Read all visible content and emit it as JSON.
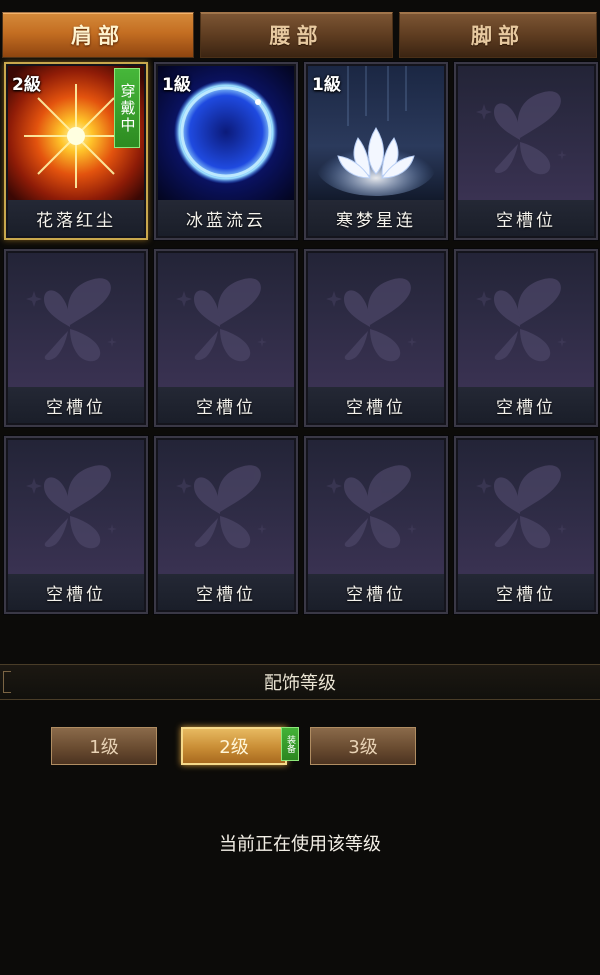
{
  "tabs": [
    {
      "label": "肩部",
      "active": true
    },
    {
      "label": "腰部",
      "active": false
    },
    {
      "label": "脚部",
      "active": false
    }
  ],
  "slots": [
    {
      "name": "花落红尘",
      "level": "2級",
      "badge": "穿戴中",
      "art": "sun-burst-icon",
      "selected": true
    },
    {
      "name": "冰蓝流云",
      "level": "1級",
      "badge": "",
      "art": "blue-orb-icon",
      "selected": false
    },
    {
      "name": "寒梦星连",
      "level": "1級",
      "badge": "",
      "art": "lotus-icon",
      "selected": false
    },
    {
      "name": "空槽位",
      "level": "",
      "badge": "",
      "art": "butterfly-icon",
      "selected": false
    },
    {
      "name": "空槽位",
      "level": "",
      "badge": "",
      "art": "butterfly-icon",
      "selected": false
    },
    {
      "name": "空槽位",
      "level": "",
      "badge": "",
      "art": "butterfly-icon",
      "selected": false
    },
    {
      "name": "空槽位",
      "level": "",
      "badge": "",
      "art": "butterfly-icon",
      "selected": false
    },
    {
      "name": "空槽位",
      "level": "",
      "badge": "",
      "art": "butterfly-icon",
      "selected": false
    },
    {
      "name": "空槽位",
      "level": "",
      "badge": "",
      "art": "butterfly-icon",
      "selected": false
    },
    {
      "name": "空槽位",
      "level": "",
      "badge": "",
      "art": "butterfly-icon",
      "selected": false
    },
    {
      "name": "空槽位",
      "level": "",
      "badge": "",
      "art": "butterfly-icon",
      "selected": false
    },
    {
      "name": "空槽位",
      "level": "",
      "badge": "",
      "art": "butterfly-icon",
      "selected": false
    }
  ],
  "level_section": {
    "title": "配饰等级",
    "buttons": [
      {
        "label": "1级",
        "active": false
      },
      {
        "label": "2级",
        "active": true,
        "badge": "装备"
      },
      {
        "label": "3级",
        "active": false
      }
    ],
    "status": "当前正在使用该等级"
  },
  "colors": {
    "active_tab": "#c46e22",
    "worn_badge": "#3aa52c",
    "selected_border": "#c9a84d"
  }
}
